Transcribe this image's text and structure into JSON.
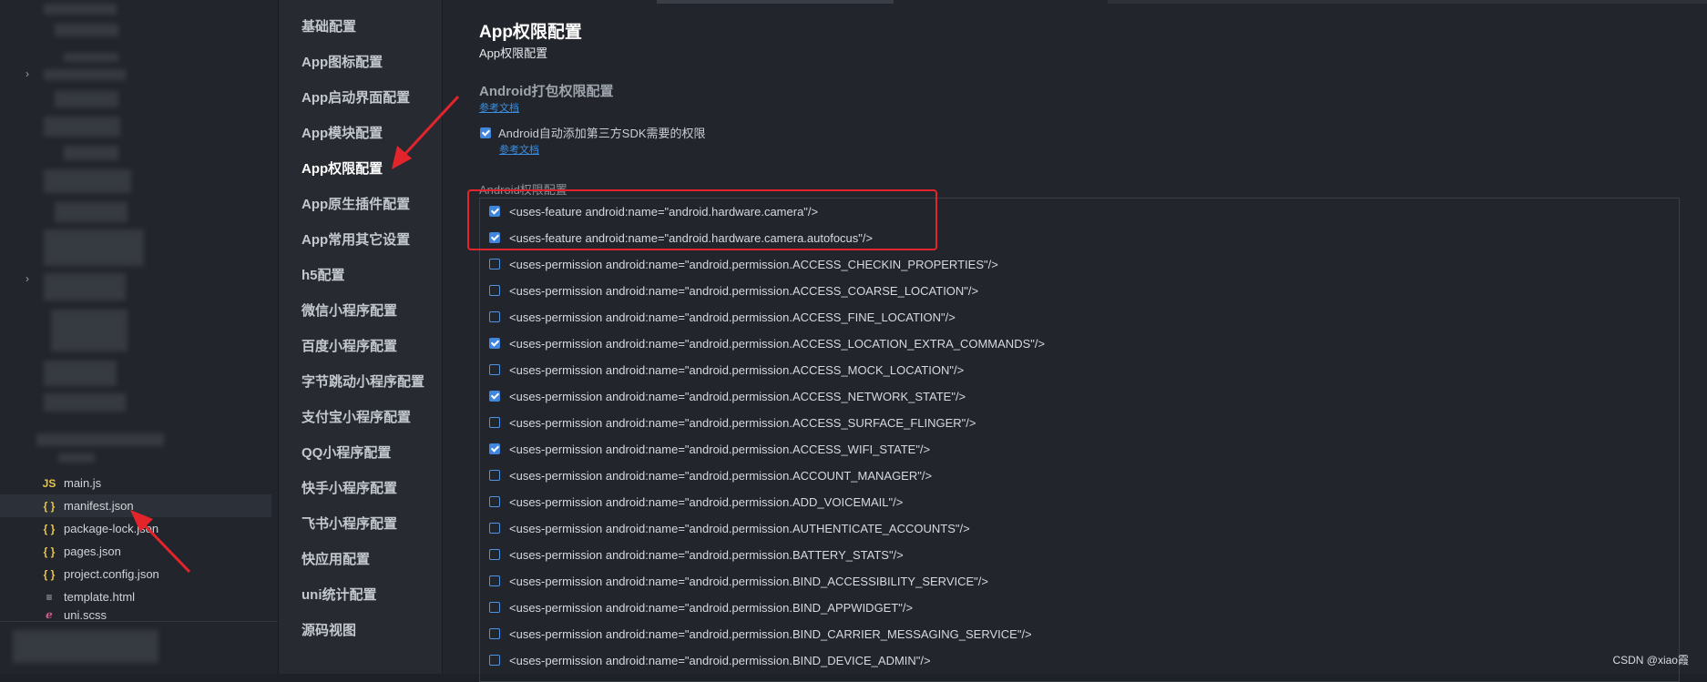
{
  "explorer": {
    "files": [
      {
        "icon": "JS",
        "name": "main.js",
        "type": "js"
      },
      {
        "icon": "{ }",
        "name": "manifest.json",
        "type": "json",
        "active": true
      },
      {
        "icon": "{ }",
        "name": "package-lock.json",
        "type": "json"
      },
      {
        "icon": "{ }",
        "name": "pages.json",
        "type": "json"
      },
      {
        "icon": "{ }",
        "name": "project.config.json",
        "type": "json"
      },
      {
        "icon": "≡",
        "name": "template.html",
        "type": "html"
      },
      {
        "icon": "ℯ",
        "name": "uni.scss",
        "type": "scss"
      }
    ]
  },
  "nav": {
    "items": [
      "基础配置",
      "App图标配置",
      "App启动界面配置",
      "App模块配置",
      "App权限配置",
      "App原生插件配置",
      "App常用其它设置",
      "h5配置",
      "微信小程序配置",
      "百度小程序配置",
      "字节跳动小程序配置",
      "支付宝小程序配置",
      "QQ小程序配置",
      "快手小程序配置",
      "飞书小程序配置",
      "快应用配置",
      "uni统计配置",
      "源码视图"
    ],
    "active_index": 4
  },
  "main": {
    "title": "App权限配置",
    "subtitle": "App权限配置",
    "section_title": "Android打包权限配置",
    "doc_link": "参考文档",
    "auto_sdk_label": "Android自动添加第三方SDK需要的权限",
    "auto_sdk_checked": true,
    "auto_sdk_doc_link": "参考文档",
    "permissions_label": "Android权限配置",
    "permissions": [
      {
        "text": "<uses-feature android:name=\"android.hardware.camera\"/>",
        "checked": true
      },
      {
        "text": "<uses-feature android:name=\"android.hardware.camera.autofocus\"/>",
        "checked": true
      },
      {
        "text": "<uses-permission android:name=\"android.permission.ACCESS_CHECKIN_PROPERTIES\"/>",
        "checked": false
      },
      {
        "text": "<uses-permission android:name=\"android.permission.ACCESS_COARSE_LOCATION\"/>",
        "checked": false
      },
      {
        "text": "<uses-permission android:name=\"android.permission.ACCESS_FINE_LOCATION\"/>",
        "checked": false
      },
      {
        "text": "<uses-permission android:name=\"android.permission.ACCESS_LOCATION_EXTRA_COMMANDS\"/>",
        "checked": true
      },
      {
        "text": "<uses-permission android:name=\"android.permission.ACCESS_MOCK_LOCATION\"/>",
        "checked": false
      },
      {
        "text": "<uses-permission android:name=\"android.permission.ACCESS_NETWORK_STATE\"/>",
        "checked": true
      },
      {
        "text": "<uses-permission android:name=\"android.permission.ACCESS_SURFACE_FLINGER\"/>",
        "checked": false
      },
      {
        "text": "<uses-permission android:name=\"android.permission.ACCESS_WIFI_STATE\"/>",
        "checked": true
      },
      {
        "text": "<uses-permission android:name=\"android.permission.ACCOUNT_MANAGER\"/>",
        "checked": false
      },
      {
        "text": "<uses-permission android:name=\"android.permission.ADD_VOICEMAIL\"/>",
        "checked": false
      },
      {
        "text": "<uses-permission android:name=\"android.permission.AUTHENTICATE_ACCOUNTS\"/>",
        "checked": false
      },
      {
        "text": "<uses-permission android:name=\"android.permission.BATTERY_STATS\"/>",
        "checked": false
      },
      {
        "text": "<uses-permission android:name=\"android.permission.BIND_ACCESSIBILITY_SERVICE\"/>",
        "checked": false
      },
      {
        "text": "<uses-permission android:name=\"android.permission.BIND_APPWIDGET\"/>",
        "checked": false
      },
      {
        "text": "<uses-permission android:name=\"android.permission.BIND_CARRIER_MESSAGING_SERVICE\"/>",
        "checked": false
      },
      {
        "text": "<uses-permission android:name=\"android.permission.BIND_DEVICE_ADMIN\"/>",
        "checked": false
      }
    ]
  },
  "watermark": "CSDN @xiao霞",
  "colors": {
    "accent": "#3f86dd",
    "annotation": "#e3242b"
  }
}
